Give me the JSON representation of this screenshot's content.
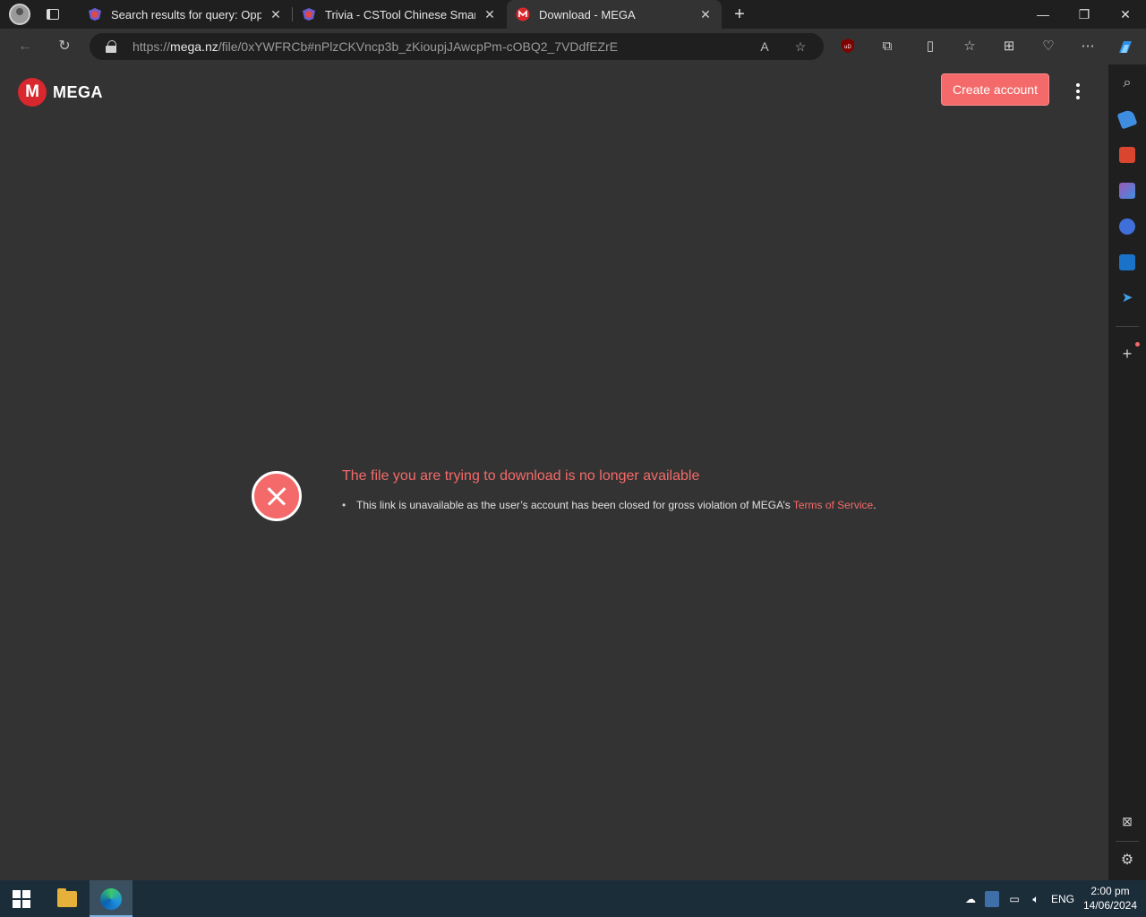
{
  "browser": {
    "tabs": [
      {
        "title": "Search results for query: Oppo br",
        "active": false
      },
      {
        "title": "Trivia - CSTool Chinese Smart Pho",
        "active": false
      },
      {
        "title": "Download - MEGA",
        "active": true
      }
    ],
    "url_scheme": "https://",
    "url_host": "mega.nz",
    "url_path": "/file/0xYWFRCb#nPlzCKVncp3b_zKioupjJAwcpPm-cOBQ2_7VDdfEZrE"
  },
  "page": {
    "logo_letter": "M",
    "logo_text": "MEGA",
    "create_account_label": "Create account",
    "error_title": "The file you are trying to download is no longer available",
    "error_detail_prefix": "This link is unavailable as the user’s account has been closed for gross violation of MEGA’s ",
    "error_detail_link": "Terms of Service",
    "error_detail_suffix": "."
  },
  "taskbar": {
    "language": "ENG",
    "time": "2:00 pm",
    "date": "14/06/2024"
  },
  "colors": {
    "mega_red": "#d9272e",
    "accent_coral": "#f46a6a",
    "page_bg": "#333333"
  }
}
